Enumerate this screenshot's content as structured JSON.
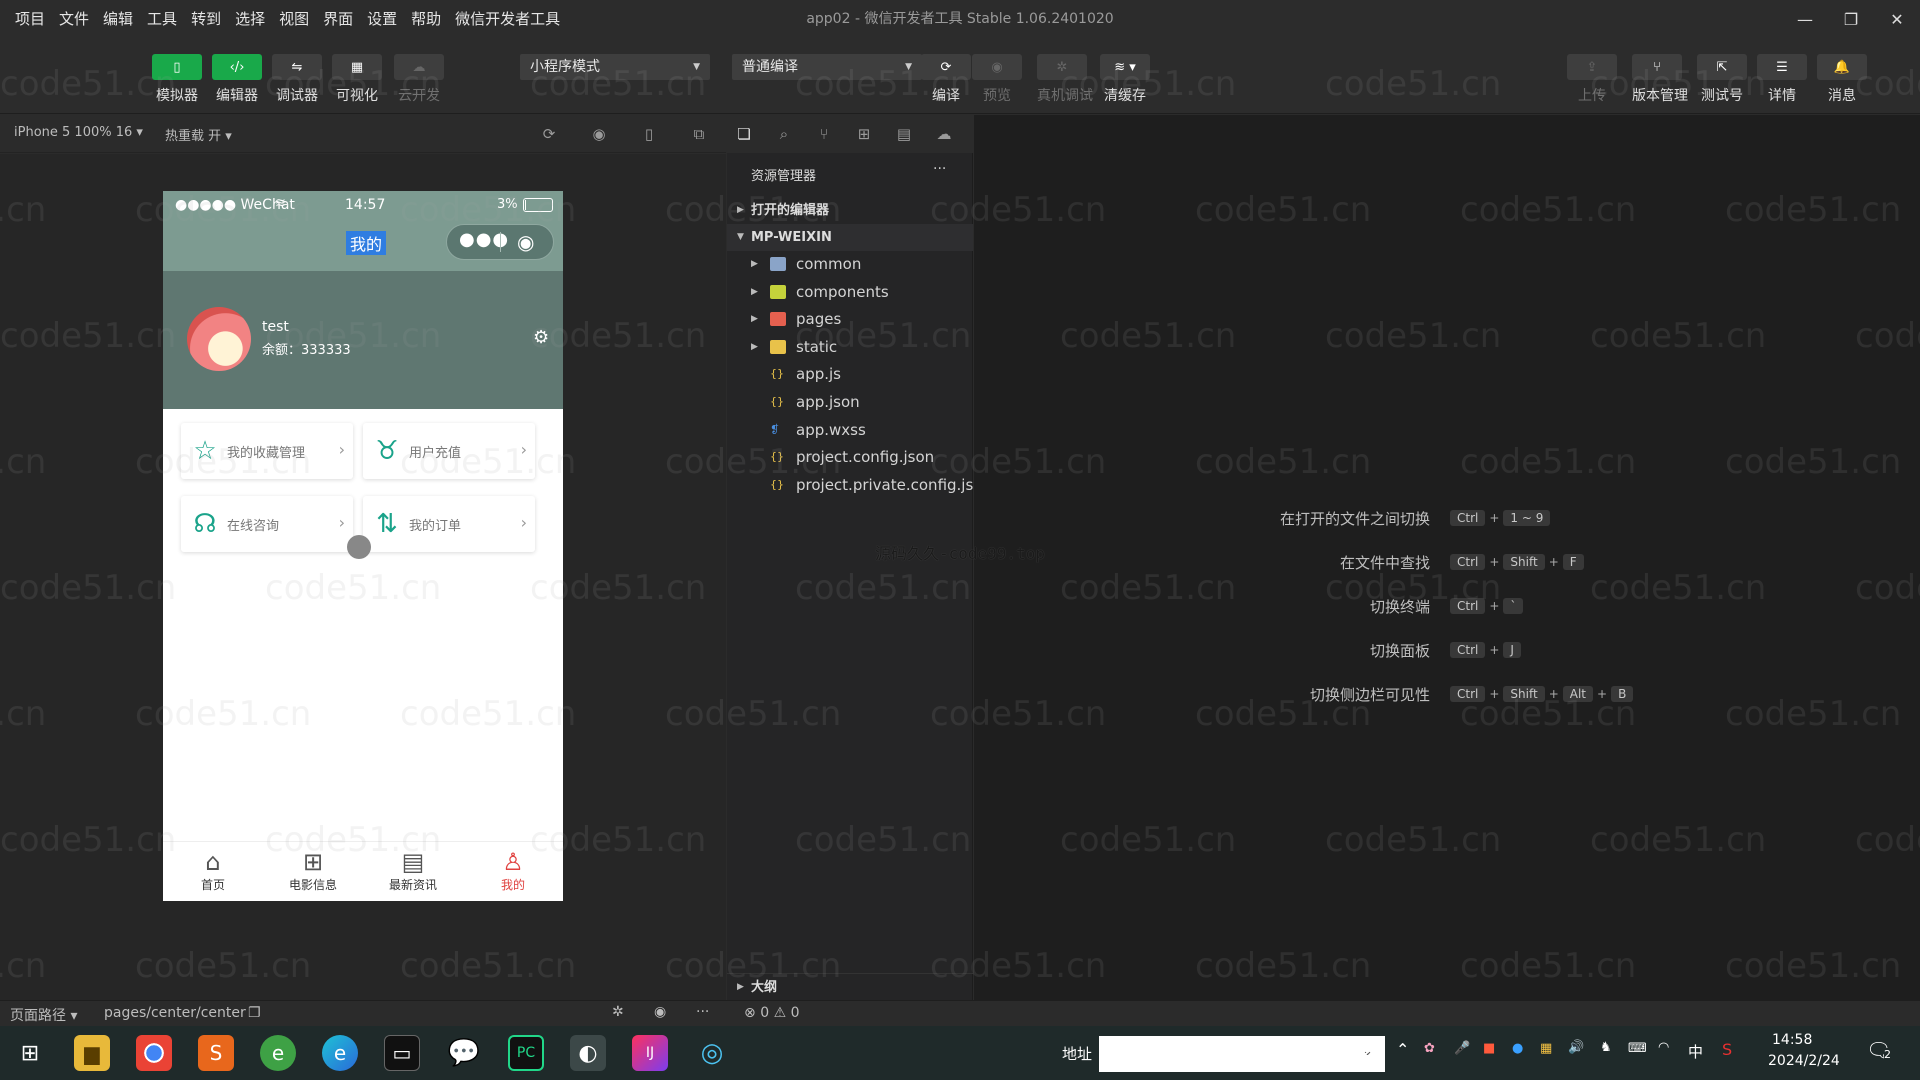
{
  "menu": [
    "项目",
    "文件",
    "编辑",
    "工具",
    "转到",
    "选择",
    "视图",
    "界面",
    "设置",
    "帮助",
    "微信开发者工具"
  ],
  "window_title": "app02 - 微信开发者工具 Stable 1.06.2401020",
  "toolbar": {
    "left_buttons": [
      {
        "label": "模拟器",
        "icon": "phone-icon",
        "active": true
      },
      {
        "label": "编辑器",
        "icon": "code-icon",
        "active": true
      },
      {
        "label": "调试器",
        "icon": "debug-icon",
        "active": false
      },
      {
        "label": "可视化",
        "icon": "layout-icon",
        "active": false
      },
      {
        "label": "云开发",
        "icon": "cloud-icon",
        "active": false,
        "disabled": true
      }
    ],
    "mode_select": "小程序模式",
    "compile_select": "普通编译",
    "center_buttons": [
      {
        "label": "编译",
        "icon": "refresh-icon",
        "disabled": false
      },
      {
        "label": "预览",
        "icon": "eye-icon",
        "disabled": true
      },
      {
        "label": "真机调试",
        "icon": "bug-icon",
        "disabled": true
      },
      {
        "label": "清缓存",
        "icon": "layers-icon",
        "disabled": false
      }
    ],
    "right_buttons": [
      {
        "label": "上传",
        "icon": "upload-icon",
        "disabled": true
      },
      {
        "label": "版本管理",
        "icon": "branch-icon",
        "disabled": false
      },
      {
        "label": "测试号",
        "icon": "external-icon",
        "disabled": false
      },
      {
        "label": "详情",
        "icon": "menu-icon",
        "disabled": false
      },
      {
        "label": "消息",
        "icon": "bell-icon",
        "disabled": false
      }
    ]
  },
  "subbar": {
    "device": "iPhone 5 100% 16",
    "hot_reload": "热重载 开"
  },
  "phone": {
    "status_left": "●●●●● WeChat",
    "time": "14:57",
    "battery": "3%",
    "nav_title": "我的",
    "user_name": "test",
    "balance": "余额：333333",
    "cards": [
      {
        "label": "我的收藏管理",
        "icon": "star-icon"
      },
      {
        "label": "用户充值",
        "icon": "money-bag-icon"
      },
      {
        "label": "在线咨询",
        "icon": "headset-icon"
      },
      {
        "label": "我的订单",
        "icon": "sort-icon"
      }
    ],
    "tabs": [
      {
        "label": "首页",
        "icon": "home-icon"
      },
      {
        "label": "电影信息",
        "icon": "grid-icon"
      },
      {
        "label": "最新资讯",
        "icon": "calendar-icon"
      },
      {
        "label": "我的",
        "icon": "user-icon"
      }
    ]
  },
  "explorer": {
    "title": "资源管理器",
    "more": "···",
    "open_editors": "打开的编辑器",
    "root": "MP-WEIXIN",
    "items": [
      {
        "name": "common",
        "type": "folder",
        "color": "#8aa4c8"
      },
      {
        "name": "components",
        "type": "folder",
        "color": "#c5d23b"
      },
      {
        "name": "pages",
        "type": "folder",
        "color": "#e5604f"
      },
      {
        "name": "static",
        "type": "folder",
        "color": "#e8c24a"
      },
      {
        "name": "app.js",
        "type": "js",
        "color": "#e8c24a"
      },
      {
        "name": "app.json",
        "type": "json",
        "color": "#e8c24a"
      },
      {
        "name": "app.wxss",
        "type": "css",
        "color": "#4a90e2"
      },
      {
        "name": "project.config.json",
        "type": "json",
        "color": "#e8c24a"
      },
      {
        "name": "project.private.config.js...",
        "type": "json",
        "color": "#e8c24a"
      }
    ],
    "outline": "大纲"
  },
  "editor": {
    "center_text": "源码久久-code99.top",
    "shortcuts": [
      {
        "label": "在打开的文件之间切换",
        "keys": [
          "Ctrl",
          "1 ~ 9"
        ]
      },
      {
        "label": "在文件中查找",
        "keys": [
          "Ctrl",
          "Shift",
          "F"
        ]
      },
      {
        "label": "切换终端",
        "keys": [
          "Ctrl",
          "`"
        ]
      },
      {
        "label": "切换面板",
        "keys": [
          "Ctrl",
          "J"
        ]
      },
      {
        "label": "切换侧边栏可见性",
        "keys": [
          "Ctrl",
          "Shift",
          "Alt",
          "B"
        ]
      }
    ]
  },
  "statusbar": {
    "page_path_label": "页面路径",
    "page_path": "pages/center/center",
    "errors": "0",
    "warnings": "0"
  },
  "taskbar": {
    "address_label": "地址",
    "time": "14:58",
    "date": "2024/2/24",
    "ime": "中",
    "notification_count": "2"
  },
  "watermark": "code51.cn"
}
